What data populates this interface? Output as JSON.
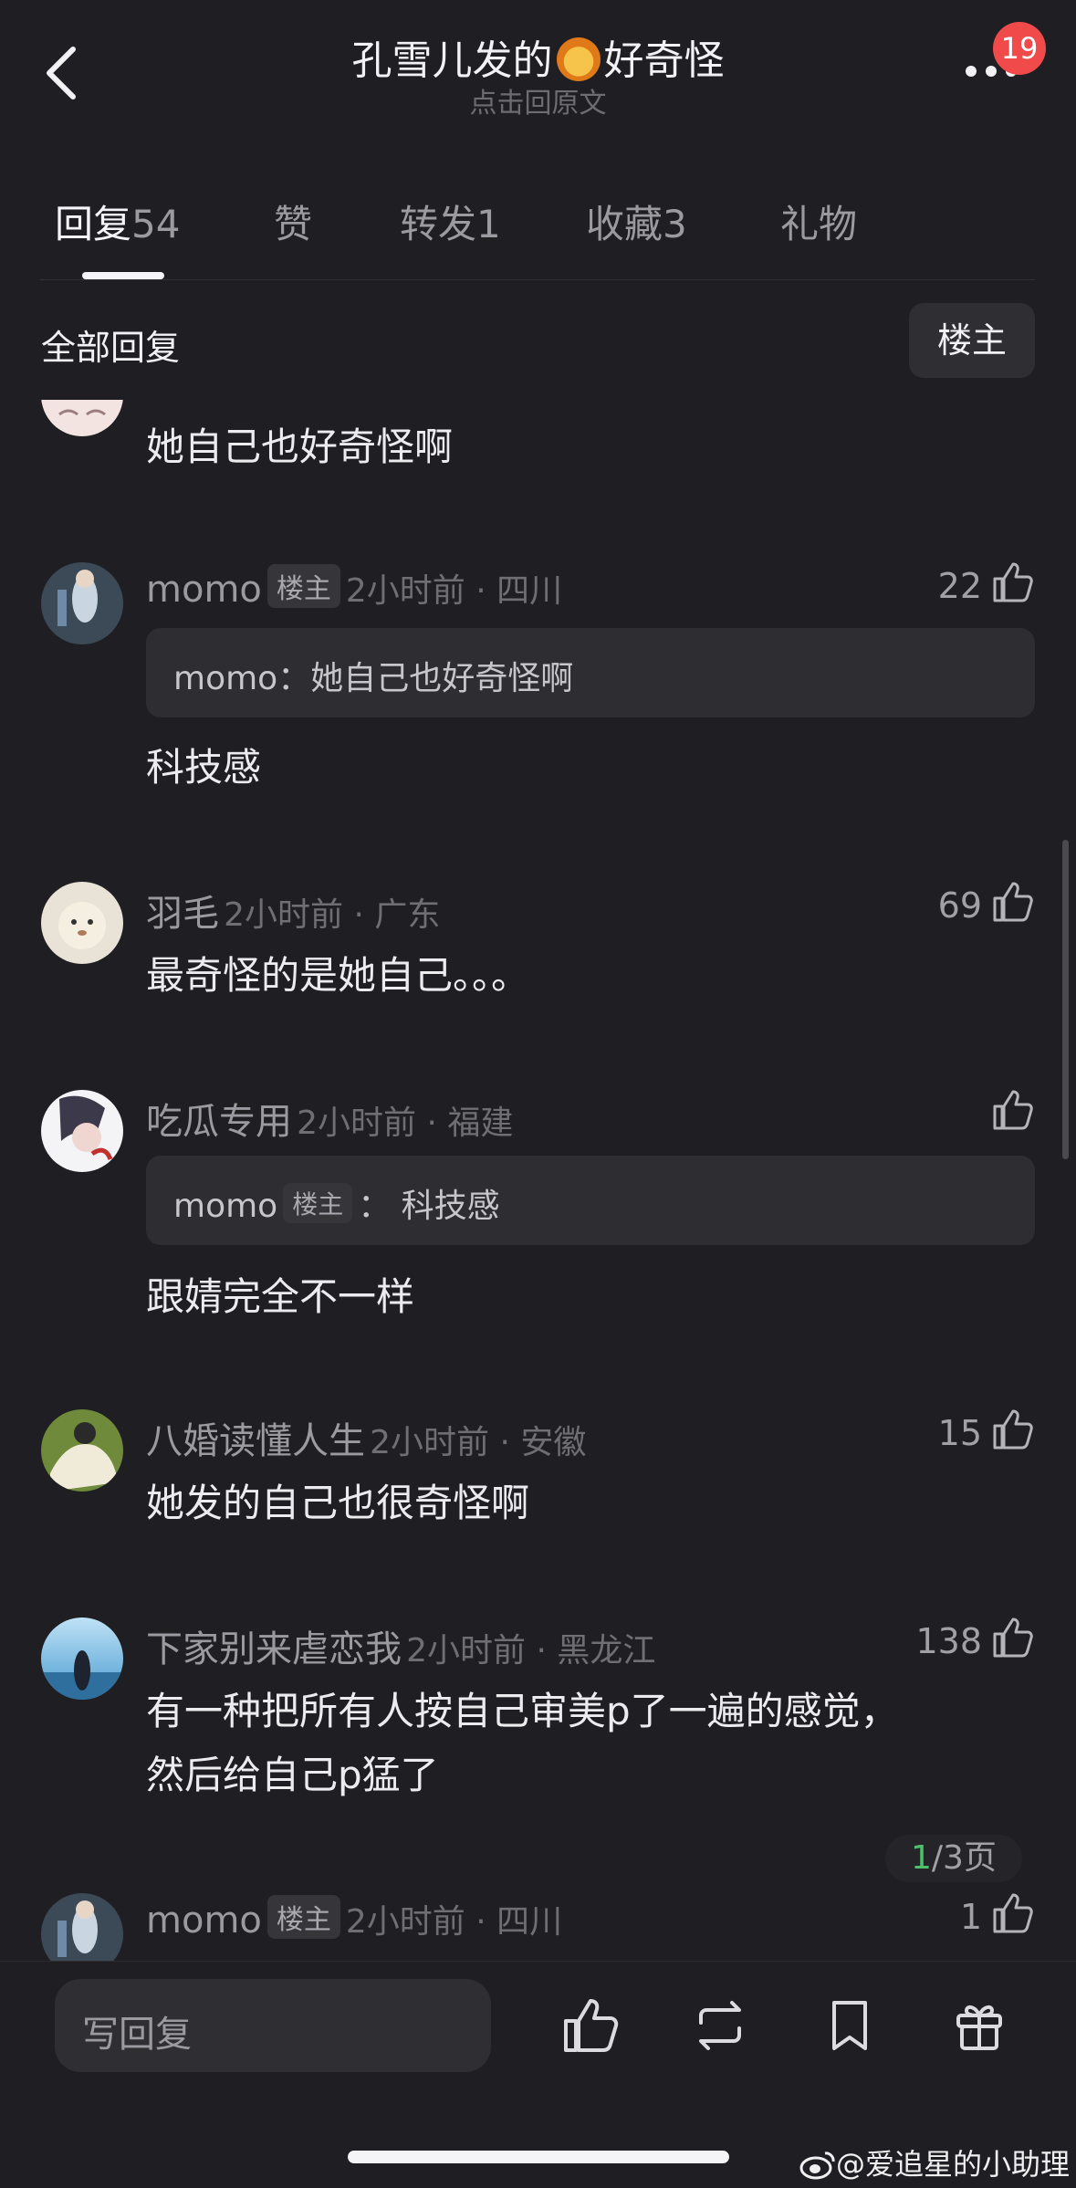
{
  "header": {
    "title_pre": "孔雪儿发的",
    "title_emoji_icon": "lion-emoji",
    "title_post": "好奇怪",
    "subtitle": "点击回原文",
    "notification_count": "19"
  },
  "tabs": [
    {
      "label": "回复",
      "count": "54",
      "active": true
    },
    {
      "label": "赞",
      "count": ""
    },
    {
      "label": "转发",
      "count": "1"
    },
    {
      "label": "收藏",
      "count": "3"
    },
    {
      "label": "礼物",
      "count": ""
    }
  ],
  "filter": {
    "all_label": "全部回复",
    "op_label": "楼主"
  },
  "comments": [
    {
      "body": "她自己也好奇怪啊"
    },
    {
      "name": "momo",
      "op_tag": "楼主",
      "meta": "2小时前 · 四川",
      "likes": "22",
      "quote": "momo：她自己也好奇怪啊",
      "body": "科技感"
    },
    {
      "name": "羽毛",
      "meta": "2小时前 · 广东",
      "likes": "69",
      "body": "最奇怪的是她自己。。。"
    },
    {
      "name": "吃瓜专用",
      "meta": "2小时前 · 福建",
      "likes": "",
      "quote_name": "momo",
      "quote_op_tag": "楼主",
      "quote_rest": "：  科技感",
      "body": "跟婧完全不一样"
    },
    {
      "name": "八婚读懂人生",
      "meta": "2小时前 · 安徽",
      "likes": "15",
      "body": "她发的自己也很奇怪啊"
    },
    {
      "name": "下家别来虐恋我",
      "meta": "2小时前 · 黑龙江",
      "likes": "138",
      "body_line1": "有一种把所有人按自己审美p了一遍的感觉，",
      "body_line2": "然后给自己p猛了"
    },
    {
      "name": "momo",
      "op_tag": "楼主",
      "meta": "2小时前 · 四川",
      "likes": "1"
    }
  ],
  "pager": {
    "current": "1",
    "rest": "/3页"
  },
  "bottom": {
    "reply_placeholder": "写回复"
  },
  "watermark": "@爱追星的小助理",
  "colors": {
    "background": "#1f1f23",
    "badge": "#f04a4a",
    "pager_current": "#4cc16a"
  }
}
